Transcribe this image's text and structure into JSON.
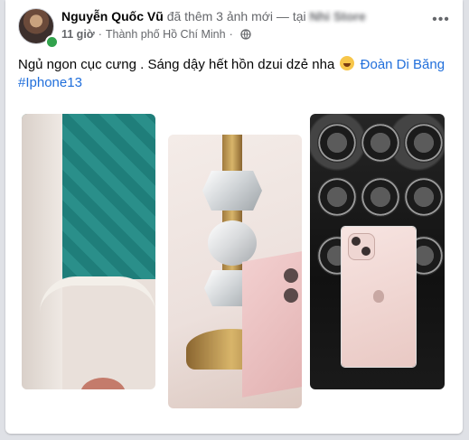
{
  "post": {
    "author": "Nguyễn Quốc Vũ",
    "action": "đã thêm 3 ảnh mới — tại",
    "page": "Nhi Store",
    "time": "11 giờ",
    "location": "Thành phố Hồ Chí Minh",
    "text_before": "Ngủ ngon cục cưng . Sáng dậy hết hồn dzui dzẻ nha",
    "mention": "Đoàn Di Băng",
    "hashtag": "#Iphone13",
    "more_icon": "more-horizontal-icon",
    "privacy_icon": "globe-icon",
    "emoji": "rolling-on-floor-laughing-emoji",
    "colors": {
      "link": "#216fdb",
      "online": "#31a24c",
      "meta": "#65676b",
      "text": "#050505"
    }
  }
}
